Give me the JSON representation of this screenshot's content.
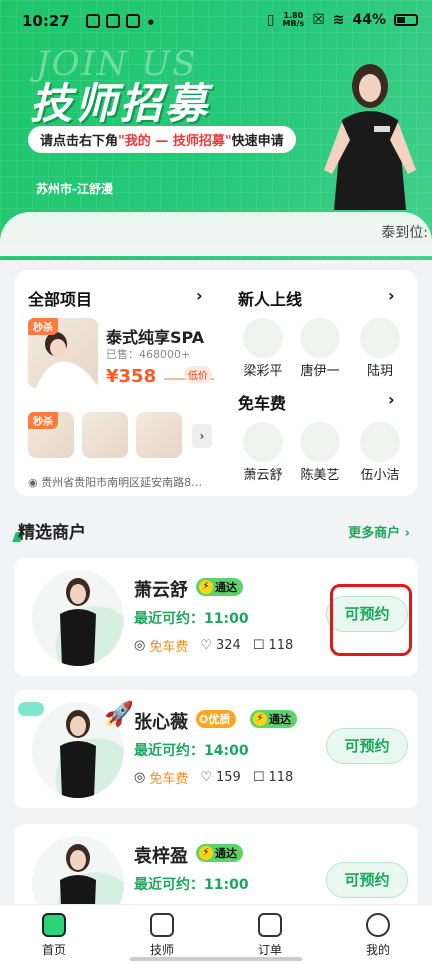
{
  "status_bar": {
    "time": "10:27",
    "speed": "1.80\nMB/s",
    "battery": "44%"
  },
  "banner": {
    "joinus": "JOIN US",
    "title": "技师招募",
    "sub_prefix": "请点击右下角",
    "sub_highlight": "\"我的 — 技师招募\"",
    "sub_suffix": "快速申请",
    "location": "苏州市-江舒漫"
  },
  "notice": "泰到位:",
  "all_projects": {
    "title": "全部项目",
    "tag": "秒杀",
    "product_name": "泰式纯享SPA",
    "sold": "已售：468000+",
    "price": "¥358",
    "low_price": "低价",
    "thumb_tag": "秒杀",
    "address": "贵州省贵阳市南明区延安南路8…"
  },
  "new_arrivals": {
    "title": "新人上线",
    "people": [
      "梁彩平",
      "唐伊一",
      "陆玥"
    ]
  },
  "free_fare": {
    "title": "免车费",
    "people": [
      "萧云舒",
      "陈美艺",
      "伍小洁"
    ]
  },
  "merchants_section": {
    "title": "精选商户",
    "more": "更多商户"
  },
  "merchants": [
    {
      "name": "萧云舒",
      "badges": [
        "通达"
      ],
      "recent": "最近可约：11:00",
      "fee": "免车费",
      "likes": "324",
      "comments": "118",
      "book": "可预约"
    },
    {
      "name": "张心薇",
      "badges": [
        "优质",
        "通达"
      ],
      "recent": "最近可约：14:00",
      "fee": "免车费",
      "likes": "159",
      "comments": "118",
      "book": "可预约"
    },
    {
      "name": "袁梓盈",
      "badges": [
        "通达"
      ],
      "recent": "最近可约：11:00",
      "book": "可预约"
    }
  ],
  "tabbar": [
    {
      "label": "首页",
      "icon": "home-icon"
    },
    {
      "label": "技师",
      "icon": "technician-icon"
    },
    {
      "label": "订单",
      "icon": "order-icon"
    },
    {
      "label": "我的",
      "icon": "profile-icon"
    }
  ],
  "colors": {
    "brand_green": "#1fc76a",
    "price_orange": "#ff5a1f",
    "highlight_red": "#e01818"
  }
}
